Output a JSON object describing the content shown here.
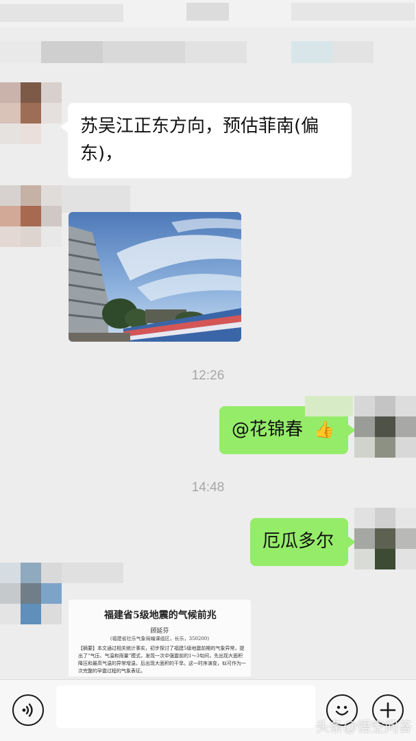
{
  "messages": {
    "m1": {
      "text": "苏吴江正东方向，预估菲南(偏东)，"
    },
    "time1": "12:26",
    "m2": {
      "text": "@花锦春"
    },
    "m2_emoji": "👍",
    "time2": "14:48",
    "m3": {
      "text": "厄瓜多尔"
    },
    "doc": {
      "title": "福建省5级地震的气候前兆",
      "author": "顾延芬",
      "affiliation": "(福建省社乐气象局编课组区，长乐，350200)",
      "abstract": "【摘要】本文通过相关统计事实，初步探讨了福建5级地震前期的气象异常，提出了“气压、气温和雨量”模式，发现一次中强震前的1～3旬间，先出现大面积降压和最高气温的异常增温，后出现大面积的干旱。这一时序演变，似可作为一次完整的孕震过程的气象表征。"
    }
  },
  "input": {
    "placeholder": ""
  },
  "icons": {
    "voice": "voice-icon",
    "emoji": "emoji-icon",
    "plus": "plus-icon",
    "thumbs": "thumbs-up-icon"
  },
  "colors": {
    "background": "#ededed",
    "green_bubble": "#95ec69",
    "white_bubble": "#ffffff"
  },
  "watermark": "头条@悟空问答"
}
